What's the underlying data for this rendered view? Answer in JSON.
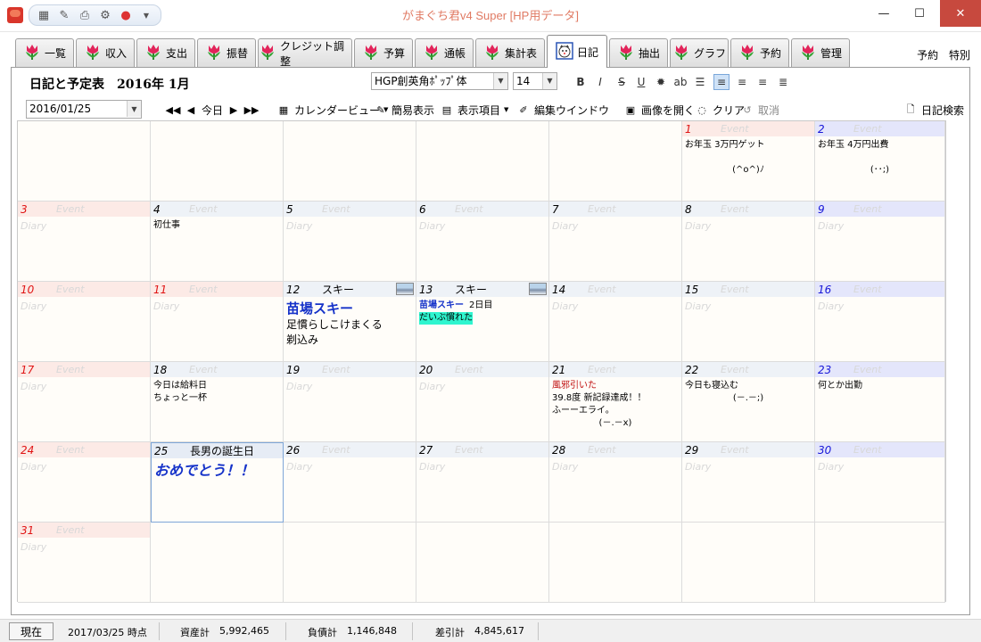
{
  "window": {
    "title": "がまぐち君v4 Super  [HP用データ]",
    "minimize_glyph": "—",
    "maximize_glyph": "☐",
    "close_glyph": "✕"
  },
  "tabs": [
    {
      "label": "一覧",
      "icon": "tulip-icon"
    },
    {
      "label": "収入",
      "icon": "tulip-icon"
    },
    {
      "label": "支出",
      "icon": "tulip-icon"
    },
    {
      "label": "振替",
      "icon": "tulip-icon"
    },
    {
      "label": "クレジット調整",
      "icon": "tulip-icon"
    },
    {
      "label": "予算",
      "icon": "tulip-icon"
    },
    {
      "label": "通帳",
      "icon": "tulip-icon"
    },
    {
      "label": "集計表",
      "icon": "tulip-icon"
    },
    {
      "label": "日記",
      "icon": "cat-icon",
      "active": true
    },
    {
      "label": "抽出",
      "icon": "tulip-icon"
    },
    {
      "label": "グラフ",
      "icon": "tulip-icon"
    },
    {
      "label": "予約",
      "icon": "tulip-icon"
    },
    {
      "label": "管理",
      "icon": "tulip-icon"
    }
  ],
  "tab_right": {
    "yoyaku": "予約",
    "tokubetsu": "特別"
  },
  "diary": {
    "heading": "日記と予定表　2016年 1月",
    "font_name": "HGP創英角ﾎﾟｯﾌﾟ体",
    "font_size": "14",
    "date_value": "2016/01/25",
    "today_label": "今日",
    "calendar_view_label": "カレンダービュー",
    "simple_view_label": "簡易表示",
    "display_items_label": "表示項目",
    "edit_window_label": "編集ウインドウ",
    "open_image_label": "画像を開く",
    "clear_label": "クリア",
    "cancel_label": "取消",
    "search_label": "日記検索",
    "placeholder_event": "Event",
    "placeholder_diary": "Diary"
  },
  "calendar_days": [
    {
      "row": 0,
      "col": 5,
      "day": "1",
      "type": "sun",
      "lines": [
        "お年玉 3万円ゲット",
        "",
        "(^o^)ﾉ"
      ]
    },
    {
      "row": 0,
      "col": 6,
      "day": "2",
      "type": "sat",
      "lines": [
        "お年玉 4万円出費",
        "",
        "(･･;)"
      ]
    },
    {
      "row": 1,
      "col": 0,
      "day": "3",
      "type": "sun"
    },
    {
      "row": 1,
      "col": 1,
      "day": "4",
      "type": "plain",
      "lines": [
        "初仕事"
      ]
    },
    {
      "row": 1,
      "col": 2,
      "day": "5",
      "type": "plain"
    },
    {
      "row": 1,
      "col": 3,
      "day": "6",
      "type": "plain"
    },
    {
      "row": 1,
      "col": 4,
      "day": "7",
      "type": "plain"
    },
    {
      "row": 1,
      "col": 5,
      "day": "8",
      "type": "plain"
    },
    {
      "row": 1,
      "col": 6,
      "day": "9",
      "type": "sat"
    },
    {
      "row": 2,
      "col": 0,
      "day": "10",
      "type": "sun"
    },
    {
      "row": 2,
      "col": 1,
      "day": "11",
      "type": "sun"
    },
    {
      "row": 2,
      "col": 2,
      "day": "12",
      "type": "plain",
      "event": "スキー",
      "thumb": true,
      "big_blue": "苗場スキー",
      "lines": [
        "足慣らしこけまくる",
        "剃込み"
      ]
    },
    {
      "row": 2,
      "col": 3,
      "day": "13",
      "type": "plain",
      "event": "スキー",
      "thumb": true,
      "blue_line": "苗場スキー",
      "blue_suffix": "2日目",
      "cyan_line": "だいぶ慣れた"
    },
    {
      "row": 2,
      "col": 4,
      "day": "14",
      "type": "plain"
    },
    {
      "row": 2,
      "col": 5,
      "day": "15",
      "type": "plain"
    },
    {
      "row": 2,
      "col": 6,
      "day": "16",
      "type": "sat"
    },
    {
      "row": 3,
      "col": 0,
      "day": "17",
      "type": "sun"
    },
    {
      "row": 3,
      "col": 1,
      "day": "18",
      "type": "plain",
      "lines": [
        "今日は給料日",
        "ちょっと一杯"
      ]
    },
    {
      "row": 3,
      "col": 2,
      "day": "19",
      "type": "plain"
    },
    {
      "row": 3,
      "col": 3,
      "day": "20",
      "type": "plain"
    },
    {
      "row": 3,
      "col": 4,
      "day": "21",
      "type": "plain",
      "red_line": "風邪引いた",
      "lines": [
        "39.8度 新記録達成！！",
        "ふーーエライ。",
        "(－.－x)"
      ]
    },
    {
      "row": 3,
      "col": 5,
      "day": "22",
      "type": "plain",
      "lines": [
        "今日も寝込む",
        "(－.－;)"
      ]
    },
    {
      "row": 3,
      "col": 6,
      "day": "23",
      "type": "sat",
      "lines": [
        "何とか出勤"
      ]
    },
    {
      "row": 4,
      "col": 0,
      "day": "24",
      "type": "sun"
    },
    {
      "row": 4,
      "col": 1,
      "day": "25",
      "type": "sel",
      "event": "長男の誕生日",
      "big_italic": "おめでとう！！"
    },
    {
      "row": 4,
      "col": 2,
      "day": "26",
      "type": "plain"
    },
    {
      "row": 4,
      "col": 3,
      "day": "27",
      "type": "plain"
    },
    {
      "row": 4,
      "col": 4,
      "day": "28",
      "type": "plain"
    },
    {
      "row": 4,
      "col": 5,
      "day": "29",
      "type": "plain"
    },
    {
      "row": 4,
      "col": 6,
      "day": "30",
      "type": "sat"
    },
    {
      "row": 5,
      "col": 0,
      "day": "31",
      "type": "sun"
    }
  ],
  "status": {
    "now_button": "現在",
    "as_of": "2017/03/25 時点",
    "assets_label": "資産計",
    "assets_value": "5,992,465",
    "liabilities_label": "負債計",
    "liabilities_value": "1,146,848",
    "net_label": "差引計",
    "net_value": "4,845,617"
  }
}
